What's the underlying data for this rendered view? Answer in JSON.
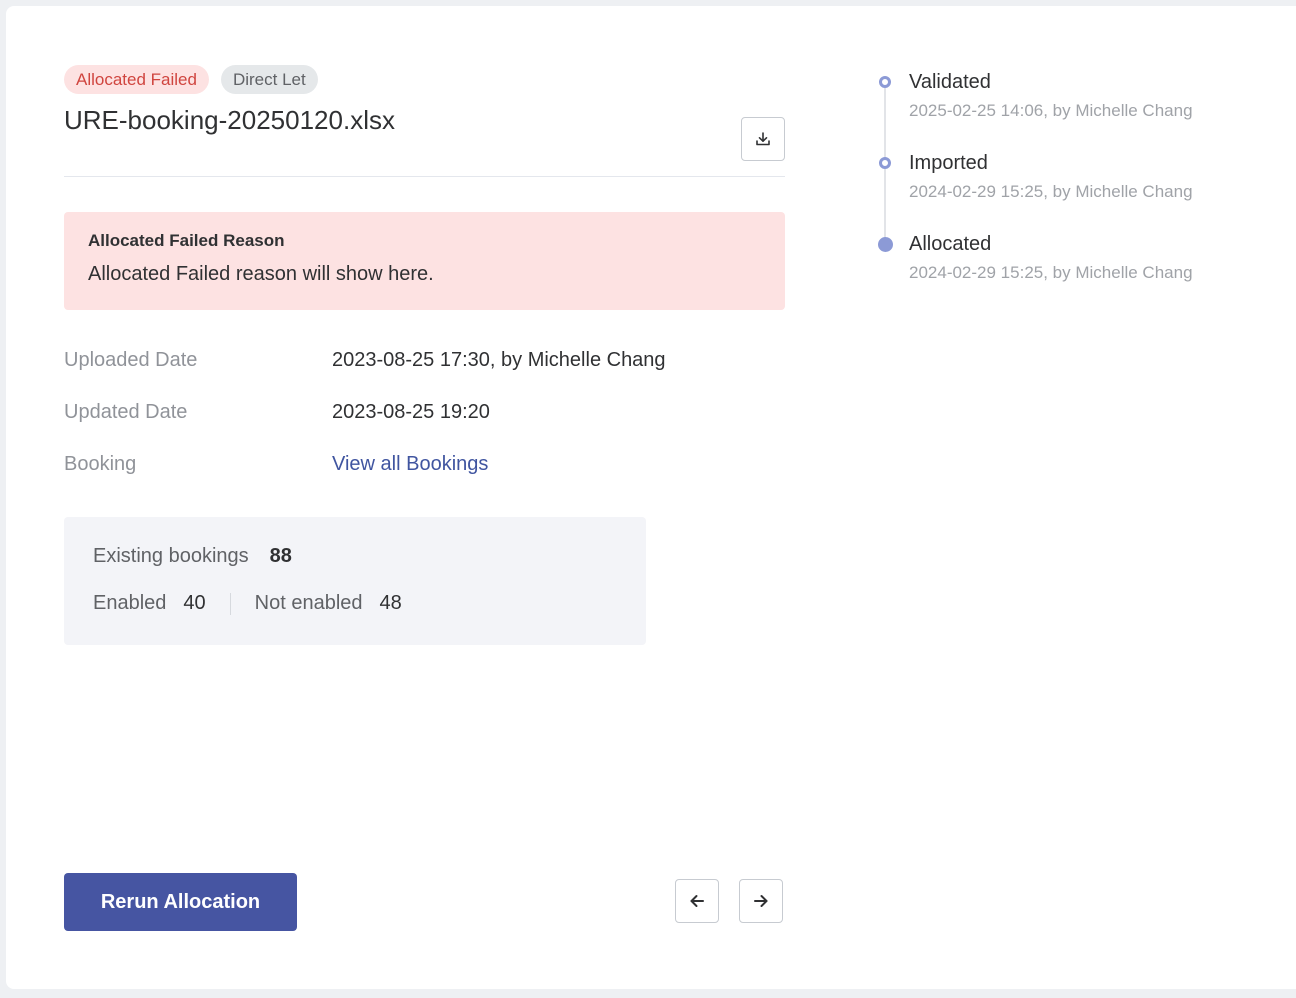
{
  "tags": {
    "status": "Allocated Failed",
    "type": "Direct Let"
  },
  "file": {
    "name": "URE-booking-20250120.xlsx",
    "download_icon": "download-icon"
  },
  "failure": {
    "title": "Allocated Failed Reason",
    "text": "Allocated Failed reason will show here."
  },
  "details": [
    {
      "label": "Uploaded Date",
      "value": "2023-08-25 17:30, by Michelle Chang"
    },
    {
      "label": "Updated Date",
      "value": "2023-08-25 19:20"
    },
    {
      "label": "Booking",
      "value": "View all Bookings"
    }
  ],
  "stats": {
    "existing_label": "Existing bookings",
    "existing_value": "88",
    "enabled_label": "Enabled",
    "enabled_value": "40",
    "not_enabled_label": "Not enabled",
    "not_enabled_value": "48"
  },
  "actions": {
    "rerun_label": "Rerun Allocation",
    "prev_icon": "arrow-left-icon",
    "next_icon": "arrow-right-icon"
  },
  "timeline": [
    {
      "title": "Validated",
      "meta": "2025-02-25 14:06, by Michelle Chang",
      "state": "done"
    },
    {
      "title": "Imported",
      "meta": "2024-02-29 15:25, by Michelle Chang",
      "state": "done"
    },
    {
      "title": "Allocated",
      "meta": "2024-02-29 15:25, by Michelle Chang",
      "state": "current"
    }
  ],
  "colors": {
    "primary": "#4655a2",
    "link": "#4055a0",
    "failed_bg": "#fde2e2",
    "failed_text": "#d0453f",
    "timeline_dot": "#8c9ad6"
  }
}
